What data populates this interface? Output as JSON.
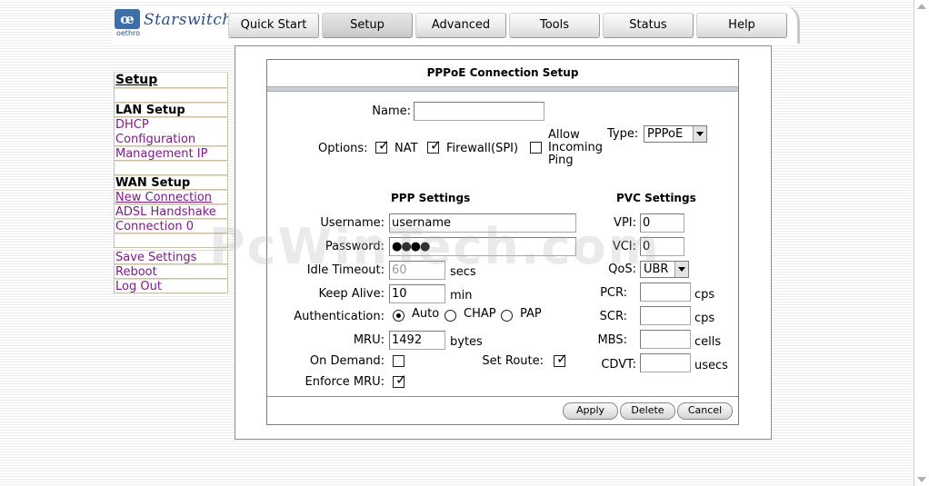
{
  "logo": {
    "mark": "œ",
    "sub": "oethro",
    "brand": "Starswitch"
  },
  "tabs": [
    {
      "label": "Quick Start"
    },
    {
      "label": "Setup"
    },
    {
      "label": "Advanced"
    },
    {
      "label": "Tools"
    },
    {
      "label": "Status"
    },
    {
      "label": "Help"
    }
  ],
  "active_tab": "Setup",
  "sidebar": {
    "title": "Setup",
    "lan_header": "LAN Setup",
    "dhcp": "DHCP Configuration",
    "management_ip": "Management IP",
    "wan_header": "WAN Setup",
    "new_connection": "New Connection",
    "adsl_handshake": "ADSL Handshake",
    "connection0": "Connection 0",
    "save_settings": "Save Settings",
    "reboot": "Reboot",
    "logout": "Log Out"
  },
  "form": {
    "title": "PPPoE Connection Setup",
    "name_label": "Name:",
    "name_value": "",
    "options_label": "Options:",
    "opt_nat": "NAT",
    "opt_firewall": "Firewall(SPI)",
    "opt_ping": "Allow Incoming Ping",
    "nat_checked": true,
    "firewall_checked": true,
    "ping_checked": false,
    "type_label": "Type:",
    "type_value": "PPPoE",
    "ppp_header": "PPP Settings",
    "pvc_header": "PVC Settings",
    "username_label": "Username:",
    "username_value": "username",
    "password_label": "Password:",
    "password_value": "●●●●",
    "idle_label": "Idle Timeout:",
    "idle_value": "60",
    "idle_unit": "secs",
    "keepalive_label": "Keep Alive:",
    "keepalive_value": "10",
    "keepalive_unit": "min",
    "auth_label": "Authentication:",
    "auth_auto": "Auto",
    "auth_chap": "CHAP",
    "auth_pap": "PAP",
    "auth_selected": "Auto",
    "mru_label": "MRU:",
    "mru_value": "1492",
    "mru_unit": "bytes",
    "ondemand_label": "On Demand:",
    "ondemand_checked": false,
    "setroute_label": "Set Route:",
    "setroute_checked": true,
    "enforce_label": "Enforce MRU:",
    "enforce_checked": true,
    "vpi_label": "VPI:",
    "vpi_value": "0",
    "vci_label": "VCI:",
    "vci_value": "0",
    "qos_label": "QoS:",
    "qos_value": "UBR",
    "pcr_label": "PCR:",
    "pcr_value": "",
    "pcr_unit": "cps",
    "scr_label": "SCR:",
    "scr_value": "",
    "scr_unit": "cps",
    "mbs_label": "MBS:",
    "mbs_value": "",
    "mbs_unit": "cells",
    "cdvt_label": "CDVT:",
    "cdvt_value": "",
    "cdvt_unit": "usecs",
    "apply": "Apply",
    "delete": "Delete",
    "cancel": "Cancel"
  },
  "watermark": "PcWinTech.com",
  "tick_glyph": "✓",
  "colors": {
    "link": "#7a1d86",
    "brand": "#2a4f86",
    "band": "#c6cdd4"
  }
}
